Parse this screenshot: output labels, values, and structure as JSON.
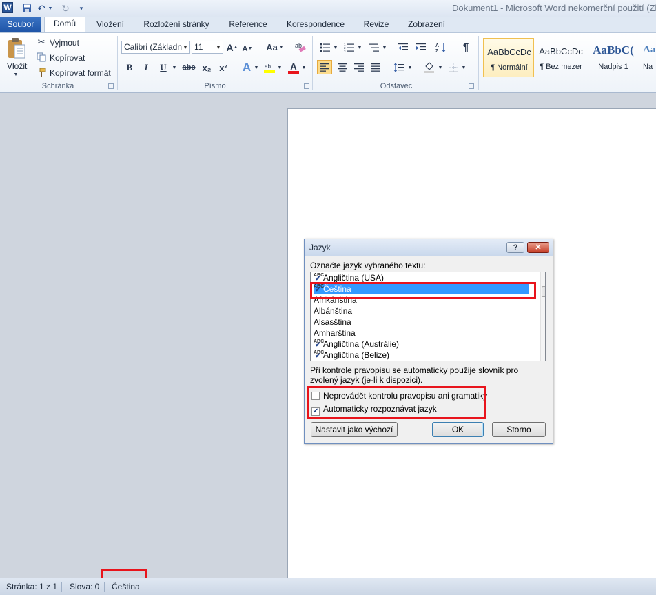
{
  "window": {
    "title": "Dokument1 - Microsoft Word nekomerční použití (Zk",
    "app_icon": "W",
    "quick_access": [
      "save-icon",
      "undo-icon",
      "redo-icon",
      "customize-icon"
    ]
  },
  "tabs": {
    "file": "Soubor",
    "items": [
      "Domů",
      "Vložení",
      "Rozložení stránky",
      "Reference",
      "Korespondence",
      "Revize",
      "Zobrazení"
    ],
    "active": "Domů"
  },
  "ribbon": {
    "clipboard": {
      "group_label": "Schránka",
      "paste": "Vložit",
      "cut": "Vyjmout",
      "copy": "Kopírovat",
      "format_painter": "Kopírovat formát"
    },
    "font": {
      "group_label": "Písmo",
      "font_name": "Calibri (Základn",
      "font_size": "11",
      "grow": "A",
      "shrink": "A",
      "case": "Aa",
      "bold": "B",
      "italic": "I",
      "underline": "U",
      "strike": "abc",
      "subscript": "x₂",
      "superscript": "x²",
      "text_effects": "A",
      "font_color": "A"
    },
    "paragraph": {
      "group_label": "Odstavec",
      "pilcrow": "¶"
    },
    "styles": [
      {
        "sample": "AaBbCcDc",
        "name": "¶ Normální"
      },
      {
        "sample": "AaBbCcDc",
        "name": "¶ Bez mezer"
      },
      {
        "sample": "AaBbC(",
        "name": "Nadpis 1"
      },
      {
        "sample": "Aa",
        "name": "Na"
      }
    ]
  },
  "dialog": {
    "title": "Jazyk",
    "help": "?",
    "close": "✕",
    "prompt": "Označte jazyk vybraného textu:",
    "languages": [
      {
        "name": "Angličtina (USA)",
        "spell": true
      },
      {
        "name": "Čeština",
        "spell": true,
        "selected": true
      },
      {
        "name": "Afrikánština",
        "spell": false
      },
      {
        "name": "Albánština",
        "spell": false
      },
      {
        "name": "Alsasština",
        "spell": false
      },
      {
        "name": "Amharština",
        "spell": false
      },
      {
        "name": "Angličtina (Austrálie)",
        "spell": true
      },
      {
        "name": "Angličtina (Belize)",
        "spell": true
      }
    ],
    "note": "Při kontrole pravopisu se automaticky použije slovník pro zvolený jazyk (je-li k dispozici).",
    "checkbox_no_proof": {
      "label": "Neprovádět kontrolu pravopisu ani gramatiky",
      "checked": false
    },
    "checkbox_autodetect": {
      "label": "Automaticky rozpoznávat jazyk",
      "checked": true
    },
    "btn_default": "Nastavit jako výchozí",
    "btn_ok": "OK",
    "btn_cancel": "Storno"
  },
  "statusbar": {
    "page": "Stránka: 1 z 1",
    "words": "Slova: 0",
    "language": "Čeština"
  },
  "colors": {
    "highlight": "#e8141c",
    "file_tab": "#2b64b8",
    "selection": "#3399ff"
  }
}
